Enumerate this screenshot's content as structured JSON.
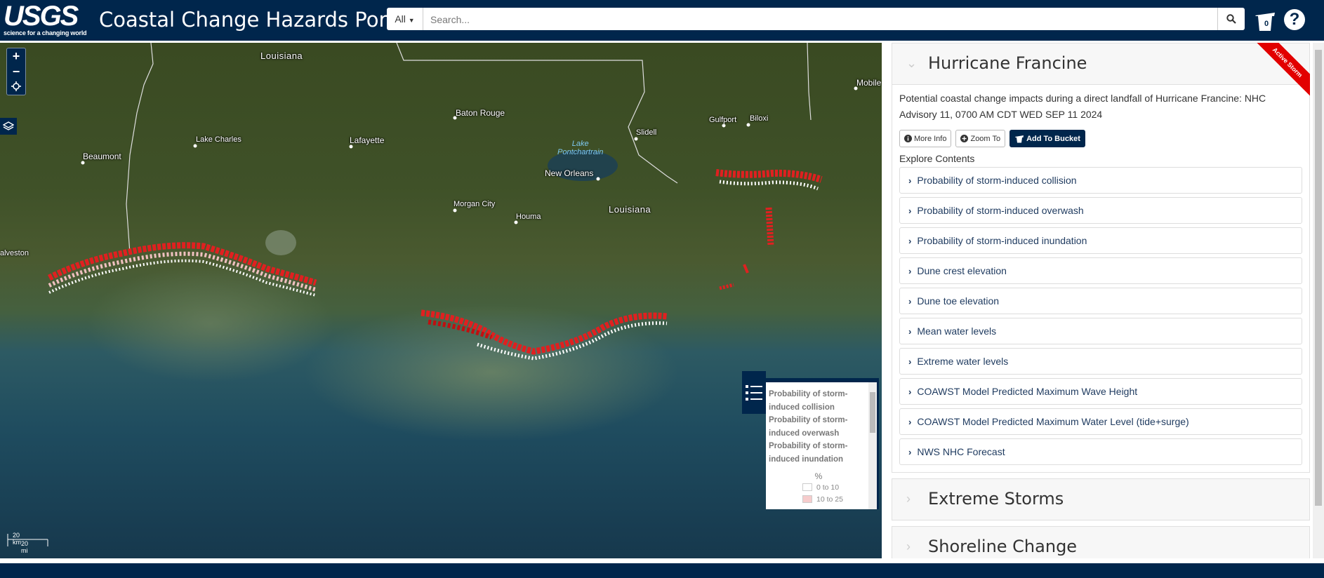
{
  "header": {
    "logo_main": "USGS",
    "logo_sub": "science for a changing world",
    "title": "Coastal Change Hazards Portal",
    "search": {
      "category": "All",
      "placeholder": "Search..."
    },
    "bucket_count": "0",
    "help_label": "?"
  },
  "map": {
    "labels": {
      "louisiana_n": "Louisiana",
      "mobile": "Mobile",
      "baton_rouge": "Baton Rouge",
      "lafayette": "Lafayette",
      "lake_charles": "Lake Charles",
      "beaumont": "Beaumont",
      "gulfport": "Gulfport",
      "biloxi": "Biloxi",
      "slidell": "Slidell",
      "lake": "Lake\nPontchartrain",
      "new_orleans": "New Orleans",
      "morgan_city": "Morgan City",
      "houma": "Houma",
      "louisiana_s": "Louisiana",
      "galveston": "alveston"
    },
    "zoom_in": "+",
    "zoom_out": "−",
    "scale_km": "20 km",
    "scale_mi": "20 mi",
    "legend": {
      "items": [
        "Probability of storm-induced collision",
        "Probability of storm-induced overwash",
        "Probability of storm-induced inundation"
      ],
      "unit": "%",
      "swatches": [
        {
          "label": "0 to 10",
          "color": "#ffffff"
        },
        {
          "label": "10 to 25",
          "color": "#f6cccc"
        }
      ]
    }
  },
  "panel": {
    "active": {
      "title": "Hurricane Francine",
      "ribbon": "Active Storm",
      "description": "Potential coastal change impacts during a direct landfall of Hurricane Francine: NHC Advisory 11, 0700 AM CDT WED SEP 11 2024",
      "buttons": {
        "more_info": "More Info",
        "zoom_to": "Zoom To",
        "add_to_bucket": "Add To Bucket"
      },
      "explore_label": "Explore Contents",
      "items": [
        "Probability of storm-induced collision",
        "Probability of storm-induced overwash",
        "Probability of storm-induced inundation",
        "Dune crest elevation",
        "Dune toe elevation",
        "Mean water levels",
        "Extreme water levels",
        "COAWST Model Predicted Maximum Wave Height",
        "COAWST Model Predicted Maximum Water Level (tide+surge)",
        "NWS NHC Forecast"
      ]
    },
    "sections": [
      "Extreme Storms",
      "Shoreline Change"
    ]
  },
  "colors": {
    "brand": "#00264c",
    "hazard": "#e02020"
  }
}
